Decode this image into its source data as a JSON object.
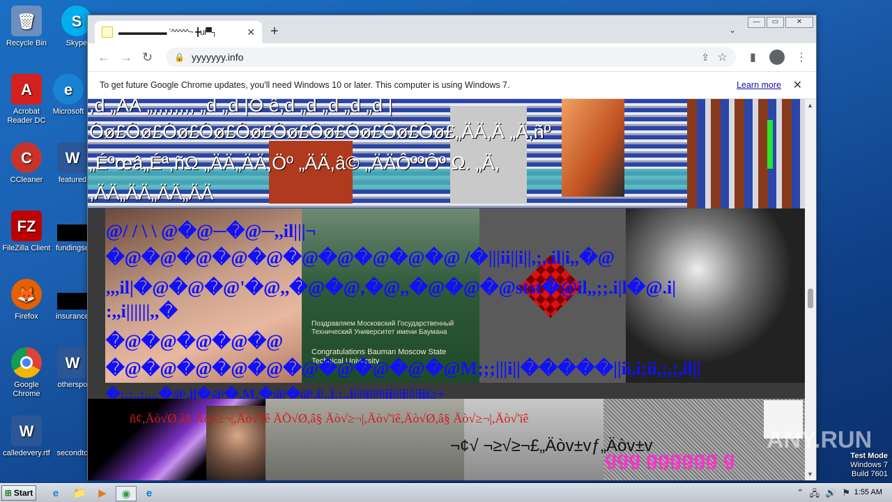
{
  "desktop": {
    "icons": [
      {
        "label": "Recycle Bin",
        "glyph": "🗑",
        "color": "#4a6fa5"
      },
      {
        "label": "Skype",
        "glyph": "S",
        "color": "#00aff0"
      },
      {
        "label": "Acrobat Reader DC",
        "glyph": "A",
        "color": "#d4201f"
      },
      {
        "label": "Microsoft",
        "glyph": "e",
        "color": "#1a82d2"
      },
      {
        "label": "CCleaner",
        "glyph": "C",
        "color": "#c9342a"
      },
      {
        "label": "featured",
        "glyph": "W",
        "color": "#2b5797"
      },
      {
        "label": "FileZilla Client",
        "glyph": "FZ",
        "color": "#bf0000"
      },
      {
        "label": "fundingse",
        "glyph": "",
        "color": "#000000"
      },
      {
        "label": "Firefox",
        "glyph": "🦊",
        "color": "#e66000"
      },
      {
        "label": "insurance",
        "glyph": "",
        "color": "#000000"
      },
      {
        "label": "Google Chrome",
        "glyph": "◉",
        "color": "#2f9e44"
      },
      {
        "label": "otherspo",
        "glyph": "W",
        "color": "#2b5797"
      },
      {
        "label": "calledevery.rtf",
        "glyph": "W",
        "color": "#2b5797"
      },
      {
        "label": "secondto",
        "glyph": "",
        "color": "#000000"
      }
    ]
  },
  "browser": {
    "tab_title": "▬▬▬▬▬▬ `^^^^^~ ╋ui▀┐",
    "tab_close": "✕",
    "new_tab": "+",
    "tab_menu": "⌄",
    "window_controls": {
      "minimize": "—",
      "maximize": "▭",
      "close": "✕"
    },
    "nav": {
      "back": "←",
      "forward": "→",
      "reload": "↻"
    },
    "url": "yyyyyyy.info",
    "lock": "🔒",
    "share": "⇪",
    "star": "☆",
    "sidepanel": "▮",
    "menu": "⋮",
    "infobar_text": "To get future Google Chrome updates, you'll need Windows 10 or later. This computer is using Windows 7.",
    "infobar_link": "Learn more",
    "infobar_close": "✕"
  },
  "page": {
    "garble_lines": [
      ",d „ÄÄ „,,,,,,,, „d „d |Ò ê,d „d „d „d „d |",
      "Ôø£Ôø£Ôø£Ôø£Ôø£Ôø£Ôø£Ôø£Ôø£Ôø£„ÄÄ,Ä „Ä,ñº",
      "„Éºœâ„Éª,ñΩ „ÄÄ„ÄÄ,Öº „ÄÄ,â© „ÄÄÔººÔº Ω. „Ä,",
      ",ÄÄ„ÄÄ„ÄÄ„ÄÄ"
    ],
    "blue_lines": [
      "@/ / \\ \\ @�@─�@─,,il|||¬",
      "�@�@�@�@�@�@�@�@�@�@ /�|||ii||i||,;,.il|i,,�@",
      ",,,il|�@�@�@'�@,,�@�@,�@,,�@�@�@stst�@il,,;;.i|l�@.i|",
      ":,,i||||||,,�",
      "�@�@�@�@�@",
      "�@�@�@�@�@�@�@�@�@�@M;;;|||i||�����||ii,i;ii,;,;,il||",
      "�;,;,,;,,,,�@.il�@�,M,�@�@,i|,,i,;,.i||||i|||||ii|||i||||iii≥+"
    ],
    "red_line": "ñ¢,Äò√Ø,â§ Äò√≥¬|,Äò√'ïê ÄÖ√Ø,â§ Äò√≥¬|,Äò√'ïê,Äò√Ø,â§ Äò√≥¬|,Äò√'ïê",
    "black_line": "¬¢√ ¬≥√≥¬£„Äòv±vƒ„Äòv±v",
    "pink_line": "ggg gggggg g",
    "photo_text_1": "Поздравляем Московский Государственный Технический Университет имени Баумана",
    "photo_text_2": "Congratulations Bauman Moscow State Technical University"
  },
  "overlay": {
    "watermark": "ANY.RUN",
    "testmode_line1": "Test Mode",
    "testmode_line2": "Windows 7",
    "testmode_line3": "Build 7601"
  },
  "taskbar": {
    "start_label": "Start",
    "apps": [
      {
        "name": "ie-icon",
        "glyph": "e",
        "color": "#1a82d2"
      },
      {
        "name": "explorer-icon",
        "glyph": "📁",
        "color": "#e5b64a"
      },
      {
        "name": "media-player-icon",
        "glyph": "▶",
        "color": "#e07b16"
      },
      {
        "name": "chrome-icon",
        "glyph": "◉",
        "color": "#2f9e44"
      },
      {
        "name": "edge-icon",
        "glyph": "e",
        "color": "#0a7bd6"
      }
    ],
    "tray_icons": [
      "⌃",
      "🖧",
      "🔊",
      "⚑"
    ],
    "clock": "1:55 AM"
  }
}
